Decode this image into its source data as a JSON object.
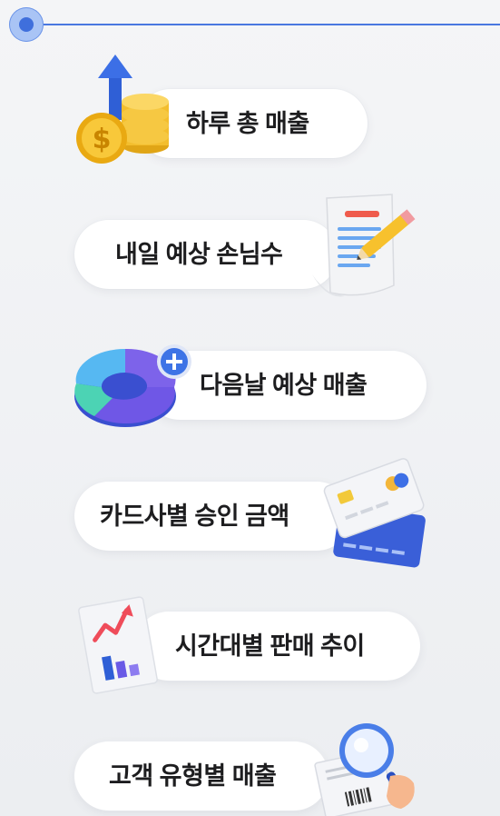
{
  "menu": {
    "items": [
      {
        "label": "하루 총 매출",
        "icon": "coins-arrow-up-icon"
      },
      {
        "label": "내일 예상 손님수",
        "icon": "receipt-pencil-icon"
      },
      {
        "label": "다음날 예상 매출",
        "icon": "donut-chart-plus-icon"
      },
      {
        "label": "카드사별 승인 금액",
        "icon": "credit-cards-icon"
      },
      {
        "label": "시간대별 판매 추이",
        "icon": "trend-report-icon"
      },
      {
        "label": "고객 유형별 매출",
        "icon": "magnifier-receipt-icon"
      }
    ]
  },
  "colors": {
    "accent": "#4a78e0",
    "text": "#1d1d1f",
    "pill": "#ffffff"
  }
}
